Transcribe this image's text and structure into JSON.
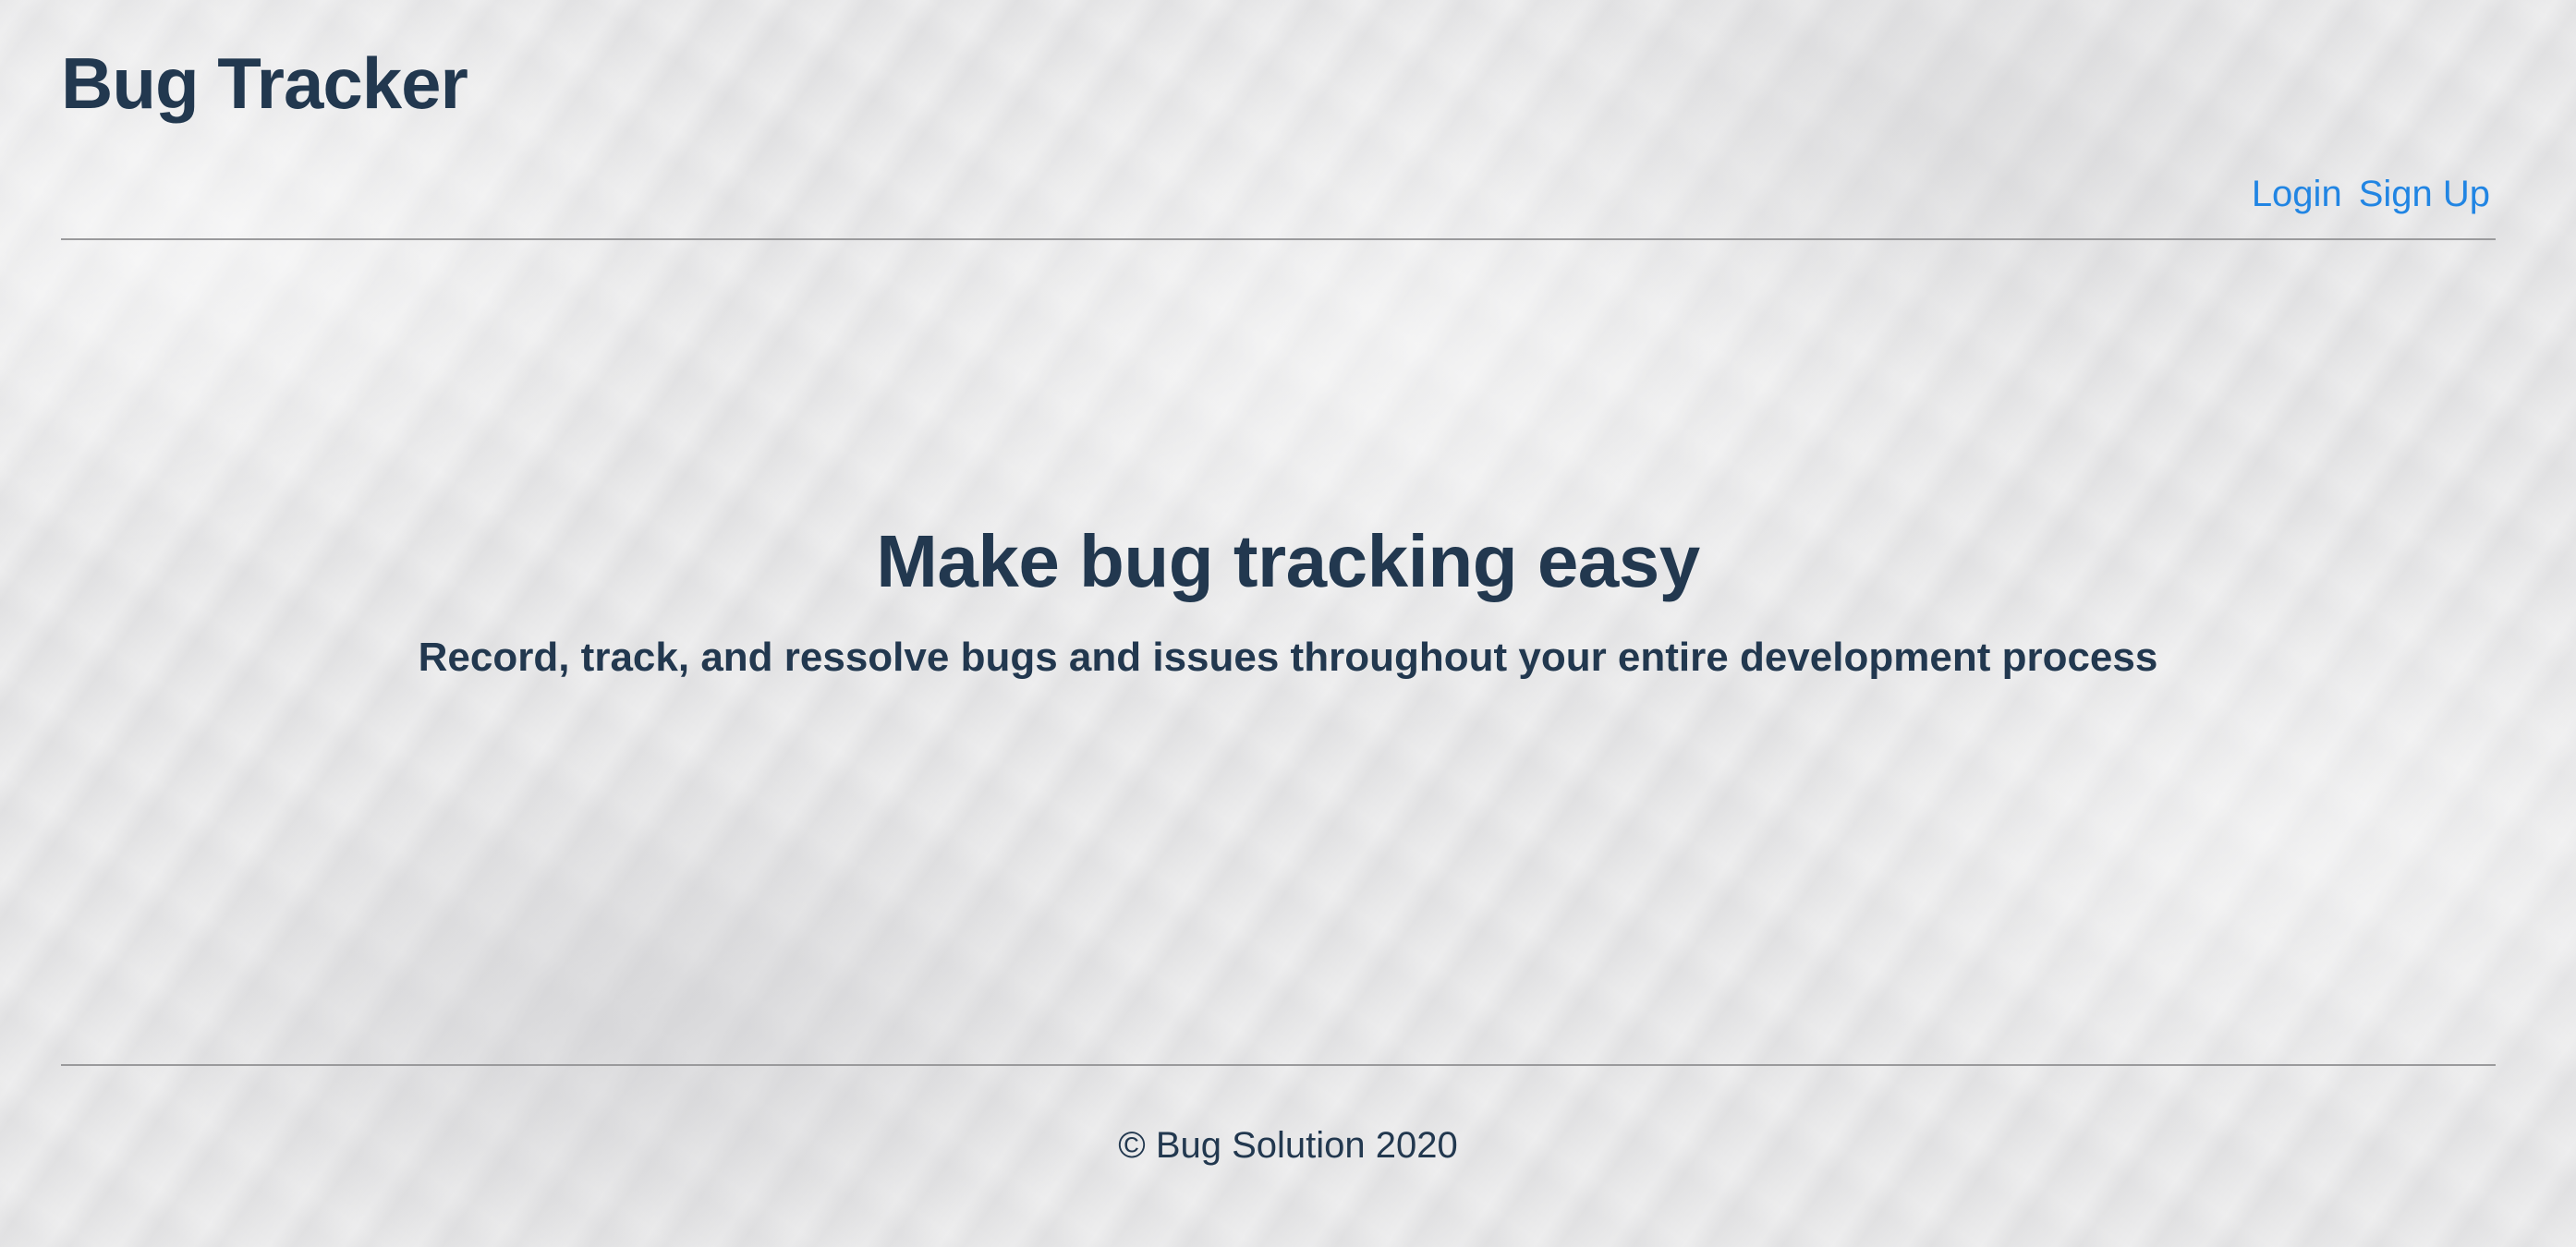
{
  "header": {
    "brand": "Bug Tracker",
    "nav": [
      {
        "label": "Login"
      },
      {
        "label": "Sign Up"
      }
    ]
  },
  "hero": {
    "title": "Make bug tracking easy",
    "subtitle": "Record, track, and ressolve bugs and issues throughout your entire development process"
  },
  "footer": {
    "copyright": "© Bug Solution 2020"
  },
  "colors": {
    "text": "#22384f",
    "link": "#2185e3",
    "divider": "#9a9a9c",
    "background": "#e7e7e8"
  }
}
